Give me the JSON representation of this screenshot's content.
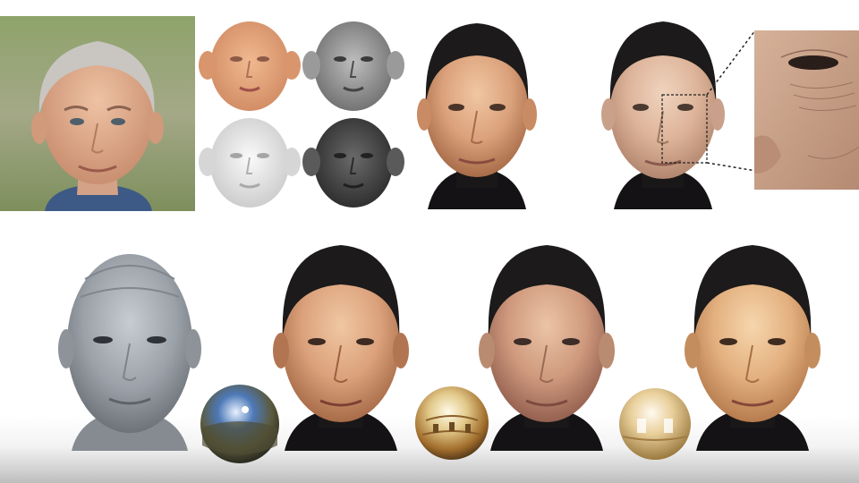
{
  "figure": {
    "panels": [
      {
        "id": "input-photo",
        "kind": "photo"
      },
      {
        "id": "diffuse-albedo-map",
        "kind": "texture-map"
      },
      {
        "id": "specular-map",
        "kind": "texture-map"
      },
      {
        "id": "normal-map",
        "kind": "texture-map"
      },
      {
        "id": "displacement-map",
        "kind": "texture-map"
      },
      {
        "id": "textured-render",
        "kind": "render"
      },
      {
        "id": "detailed-render",
        "kind": "render",
        "zoom_inset": true
      },
      {
        "id": "geometry-render",
        "kind": "render"
      },
      {
        "id": "relit-render-outdoor",
        "kind": "render"
      },
      {
        "id": "relit-render-indoor",
        "kind": "render"
      },
      {
        "id": "relit-render-warm",
        "kind": "render"
      }
    ],
    "environment_probes": [
      "outdoor-sky",
      "indoor-hall",
      "warm-room"
    ],
    "colors": {
      "skin": "#d9a37c",
      "skin_shadow": "#b57a55",
      "cap": "#1c1a1a",
      "collar": "#141214",
      "geometry_gray": "#9aa0a6",
      "photo_background": "#7f9460"
    }
  }
}
